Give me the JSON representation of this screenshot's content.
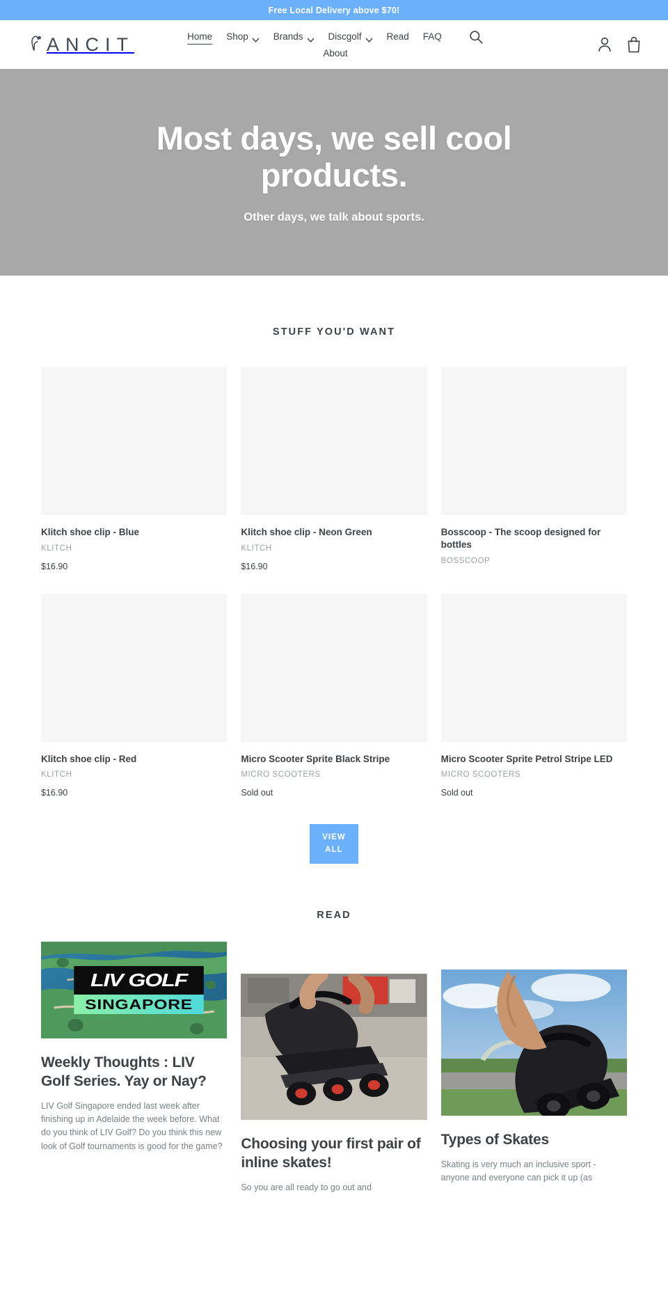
{
  "announcement": {
    "text": "Free Local Delivery above $70!",
    "bg": "#6cb0f9"
  },
  "header": {
    "logo_text": "ANCIT",
    "logo_icon": "ancit-leaf-mark",
    "nav": [
      {
        "label": "Home",
        "has_caret": false,
        "active": true
      },
      {
        "label": "Shop",
        "has_caret": true,
        "active": false
      },
      {
        "label": "Brands",
        "has_caret": true,
        "active": false
      },
      {
        "label": "Discgolf",
        "has_caret": true,
        "active": false
      },
      {
        "label": "Read",
        "has_caret": false,
        "active": false
      },
      {
        "label": "FAQ",
        "has_caret": false,
        "active": false
      },
      {
        "label": "About",
        "has_caret": false,
        "active": false
      }
    ],
    "search_icon": "search-icon",
    "account_icon": "account-person-icon",
    "cart_icon": "shopping-bag-icon"
  },
  "hero": {
    "title": "Most days, we sell cool products.",
    "subtitle": "Other days, we talk about sports.",
    "bg_color": "#a8a8a8"
  },
  "products_section": {
    "title": "STUFF YOU'D WANT",
    "items": [
      {
        "title": "Klitch shoe clip - Blue",
        "vendor": "KLITCH",
        "price": "$16.90"
      },
      {
        "title": "Klitch shoe clip - Neon Green",
        "vendor": "KLITCH",
        "price": "$16.90"
      },
      {
        "title": "Bosscoop - The scoop designed for bottles",
        "vendor": "BOSSCOOP",
        "price": ""
      },
      {
        "title": "Klitch shoe clip - Red",
        "vendor": "KLITCH",
        "price": "$16.90"
      },
      {
        "title": "Micro Scooter Sprite Black Stripe",
        "vendor": "MICRO SCOOTERS",
        "price": "Sold out"
      },
      {
        "title": "Micro Scooter Sprite Petrol Stripe LED",
        "vendor": "MICRO SCOOTERS",
        "price": "Sold out"
      }
    ],
    "view_all_label": "VIEW ALL",
    "view_all_color": "#6cb0f9"
  },
  "read_section": {
    "title": "READ",
    "articles": [
      {
        "title": "Weekly Thoughts : LIV Golf Series. Yay or Nay?",
        "excerpt": "LIV Golf Singapore ended last week after finishing up in Adelaide the week before. What do you think of LIV Golf? Do you think this new look of Golf tournaments is good for the game?",
        "image_alt": "LIV GOLF SINGAPORE banner over aerial golf course",
        "image_badge_top": "LIV GOLF",
        "image_badge_bottom": "SINGAPORE"
      },
      {
        "title": "Choosing your first pair of inline skates!",
        "excerpt": "So you are all ready to go out and",
        "image_alt": "Hands holding black inline skates with red wheels on concrete"
      },
      {
        "title": "Types of Skates",
        "excerpt": "Skating is very much an inclusive sport - anyone and everyone can pick it up (as",
        "image_alt": "Hand holding black inline skate outdoors with sky background"
      }
    ]
  }
}
